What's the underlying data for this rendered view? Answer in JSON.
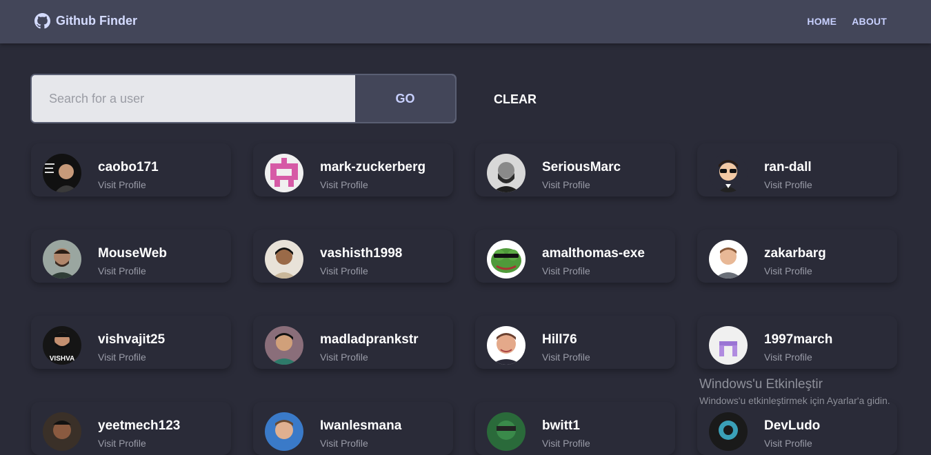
{
  "navbar": {
    "brand": "Github Finder",
    "brand_icon": "github-icon",
    "links": [
      "HOME",
      "ABOUT"
    ]
  },
  "search": {
    "placeholder": "Search for a user",
    "value": "",
    "go_label": "GO",
    "clear_label": "CLEAR"
  },
  "users": [
    {
      "login": "caobo171",
      "link": "Visit Profile"
    },
    {
      "login": "mark-zuckerberg",
      "link": "Visit Profile"
    },
    {
      "login": "SeriousMarc",
      "link": "Visit Profile"
    },
    {
      "login": "ran-dall",
      "link": "Visit Profile"
    },
    {
      "login": "MouseWeb",
      "link": "Visit Profile"
    },
    {
      "login": "vashisth1998",
      "link": "Visit Profile"
    },
    {
      "login": "amalthomas-exe",
      "link": "Visit Profile"
    },
    {
      "login": "zakarbarg",
      "link": "Visit Profile"
    },
    {
      "login": "vishvajit25",
      "link": "Visit Profile"
    },
    {
      "login": "madladprankstr",
      "link": "Visit Profile"
    },
    {
      "login": "Hill76",
      "link": "Visit Profile"
    },
    {
      "login": "1997march",
      "link": "Visit Profile"
    },
    {
      "login": "yeetmech123",
      "link": "Visit Profile"
    },
    {
      "login": "Iwanlesmana",
      "link": "Visit Profile"
    },
    {
      "login": "bwitt1",
      "link": "Visit Profile"
    },
    {
      "login": "DevLudo",
      "link": "Visit Profile"
    }
  ],
  "watermark": {
    "title": "Windows'u Etkinleştir",
    "subtitle": "Windows'u etkinleştirmek için Ayarlar'a gidin."
  },
  "colors": {
    "background": "#2a2b38",
    "navbar": "#434659",
    "accent": "#c8d0ff",
    "search_field": "#e6e7eb"
  }
}
